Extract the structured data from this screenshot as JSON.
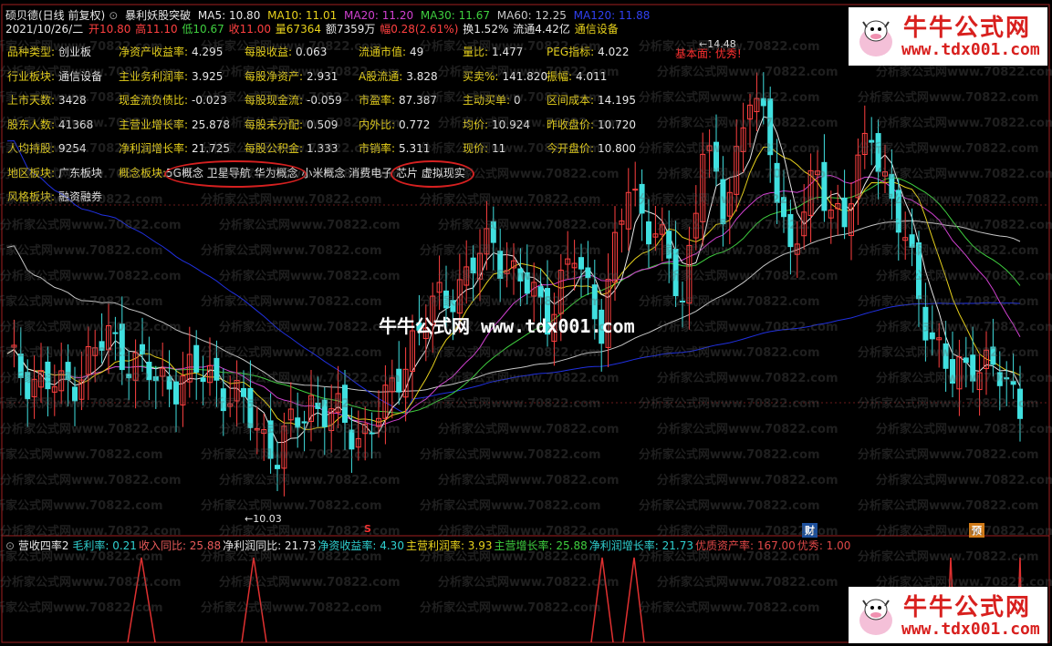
{
  "header": {
    "stock_name": "硕贝德(日线 前复权)",
    "indicator_name": "暴利妖股突破",
    "ma5": "MA5: 10.80",
    "ma10": "MA10: 11.01",
    "ma20": "MA20: 11.20",
    "ma30": "MA30: 11.67",
    "ma60": "MA60: 12.25",
    "ma120": "MA120: 11.88"
  },
  "quote": {
    "date": "2021/10/26/二",
    "open": "开10.80",
    "high": "高11.10",
    "low": "低10.67",
    "close": "收11.00",
    "volume": "量67364",
    "amount": "额7359万",
    "change": "幅0.28(2.61%)",
    "turnover": "换1.52%",
    "float": "流通4.42亿",
    "industry": "通信设备"
  },
  "fundamentals": {
    "col1": [
      {
        "k": "品种类型:",
        "v": "创业板"
      },
      {
        "k": "行业板块:",
        "v": "通信设备"
      },
      {
        "k": "上市天数:",
        "v": "3428"
      },
      {
        "k": "股东人数:",
        "v": "41368"
      },
      {
        "k": "人均持股:",
        "v": "9254"
      }
    ],
    "col2": [
      {
        "k": "净资产收益率:",
        "v": "4.295"
      },
      {
        "k": "主业务利润率:",
        "v": "3.925"
      },
      {
        "k": "现金流负债比:",
        "v": "-0.023"
      },
      {
        "k": "主营业增长率:",
        "v": "25.878"
      },
      {
        "k": "净利润增长率:",
        "v": "21.725"
      }
    ],
    "col3": [
      {
        "k": "每股收益:",
        "v": "0.063"
      },
      {
        "k": "每股净资产:",
        "v": "2.931"
      },
      {
        "k": "每股现金流:",
        "v": "-0.059"
      },
      {
        "k": "每股未分配:",
        "v": "0.509"
      },
      {
        "k": "每股公积金:",
        "v": "1.333"
      }
    ],
    "col4": [
      {
        "k": "流通市值:",
        "v": "49"
      },
      {
        "k": "A股流通:",
        "v": "3.828"
      },
      {
        "k": "市盈率:",
        "v": "87.387"
      },
      {
        "k": "内外比:",
        "v": "0.772"
      },
      {
        "k": "市销率:",
        "v": "5.311"
      }
    ],
    "col5": [
      {
        "k": "量比:",
        "v": "1.477"
      },
      {
        "k": "买卖%:",
        "v": "141.820"
      },
      {
        "k": "主动买单:",
        "v": "0"
      },
      {
        "k": "均价:",
        "v": "10.924"
      },
      {
        "k": "现价:",
        "v": "11"
      }
    ],
    "col6": [
      {
        "k": "PEG指标:",
        "v": "4.022"
      },
      {
        "k": "振幅:",
        "v": "4.011"
      },
      {
        "k": "区间成本:",
        "v": "14.195"
      },
      {
        "k": "昨收盘价:",
        "v": "10.720"
      },
      {
        "k": "今开盘价:",
        "v": "10.800"
      }
    ]
  },
  "sectors": {
    "region_label": "地区板块:",
    "region_value": "广东板块",
    "concept_label": "概念板块:",
    "concept_value": "5G概念 卫星导航 华为概念 小米概念 消费电子 芯片 虚拟现实",
    "style_label": "风格板块:",
    "style_value": "融资融券"
  },
  "annotations": {
    "high_label": "14.48",
    "low_label": "10.03",
    "rating": "基本面: 优秀!",
    "marker_s": "S",
    "marker_cai": "财",
    "marker_yu": "预"
  },
  "sub_panel": {
    "name": "营收四率2",
    "items": [
      {
        "label": "毛利率: 0.21",
        "color": "#2fd0d0"
      },
      {
        "label": "收入同比: 25.88",
        "color": "#e85a5a"
      },
      {
        "label": "净利润同比: 21.73",
        "color": "#e8e8e8"
      },
      {
        "label": "净资收益率: 4.30",
        "color": "#2fd0d0"
      },
      {
        "label": "主营利润率: 3.93",
        "color": "#e8d21c"
      },
      {
        "label": "主营增长率: 25.88",
        "color": "#3fcf3f"
      },
      {
        "label": "净利润增长率: 21.73",
        "color": "#2fd0d0"
      },
      {
        "label": "优质资产率: 167.00",
        "color": "#e04848"
      },
      {
        "label": "优秀: 1.00",
        "color": "#e04848"
      }
    ]
  },
  "watermark": {
    "text": "分析家公式网www.70822.com",
    "center": "牛牛公式网 www.tdx001.com",
    "logo_title": "牛牛公式网",
    "logo_url": "www.tdx001.com"
  },
  "colors": {
    "up": "#ff4040",
    "down": "#40e0e0",
    "ma5": "#e8e8e8",
    "ma10": "#e8d21c",
    "ma20": "#d040d0",
    "ma30": "#3fcf3f",
    "ma60": "#c8c8c8",
    "ma120": "#2030e0"
  }
}
